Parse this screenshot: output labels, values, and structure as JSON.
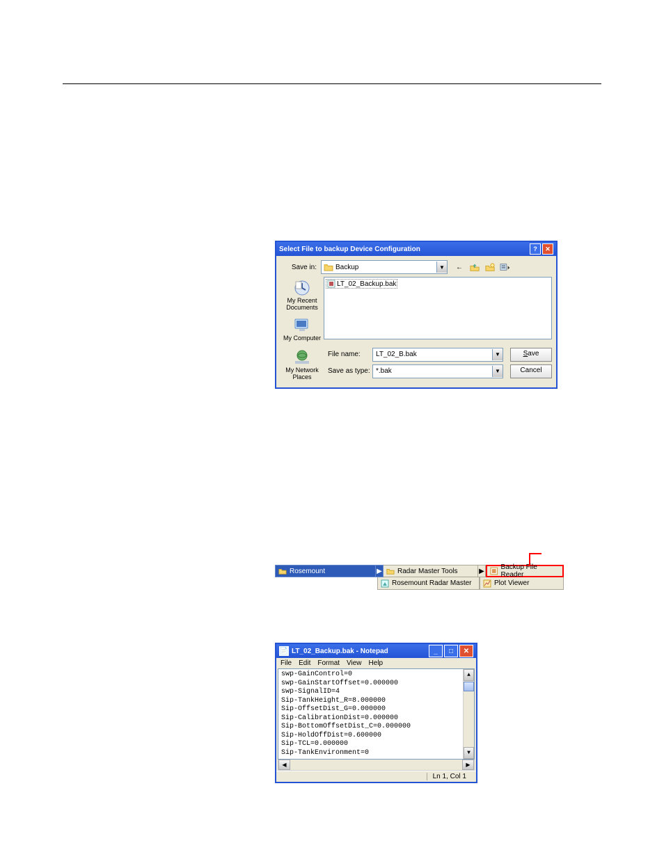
{
  "saveDialog": {
    "title": "Select File to backup Device Configuration",
    "saveInLabel": "Save in:",
    "saveInFolder": "Backup",
    "places": {
      "recentDocs": "My Recent Documents",
      "myComputer": "My Computer",
      "myNetwork": "My Network Places"
    },
    "fileListItem": "LT_02_Backup.bak",
    "fileNameLabel": "File name:",
    "fileNameValue": "LT_02_B.bak",
    "saveAsTypeLabel": "Save as type:",
    "saveAsTypeValue": "*.bak",
    "saveBtn": "Save",
    "cancelBtn": "Cancel"
  },
  "menu": {
    "rosemount": "Rosemount",
    "radarMasterTools": "Radar Master Tools",
    "backupFileReader": "Backup File Reader",
    "rosemountRadarMaster": "Rosemount Radar Master",
    "plotViewer": "Plot Viewer"
  },
  "notepad": {
    "title": "LT_02_Backup.bak - Notepad",
    "menubar": [
      "File",
      "Edit",
      "Format",
      "View",
      "Help"
    ],
    "lines": [
      "swp-GainControl=0",
      "swp-GainStartOffset=0.000000",
      "swp-SignalID=4",
      "Sip-TankHeight_R=8.000000",
      "Sip-OffsetDist_G=0.000000",
      "Sip-CalibrationDist=0.000000",
      "Sip-BottomOffsetDist_C=0.000000",
      "Sip-HoldOffDist=0.600000",
      "Sip-TCL=0.000000",
      "Sip-TankEnvironment=0"
    ],
    "status": "Ln 1, Col 1"
  }
}
